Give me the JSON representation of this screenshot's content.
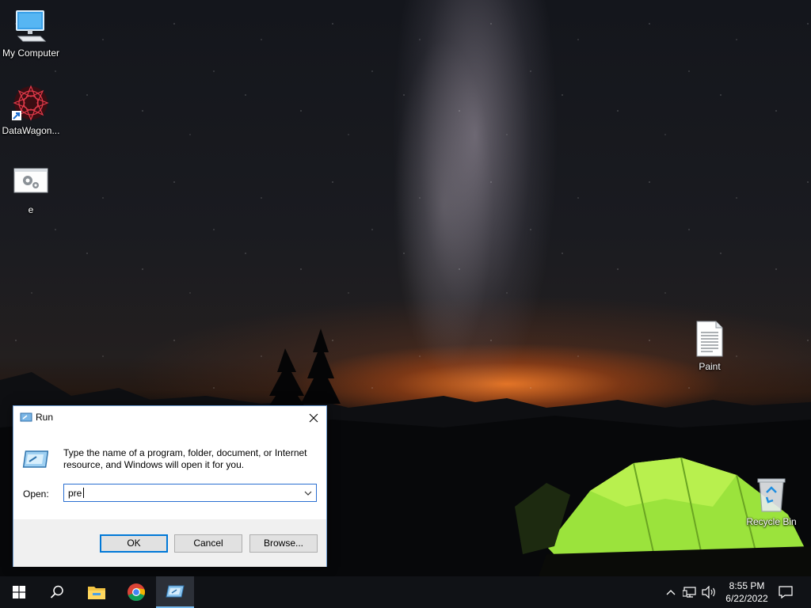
{
  "desktop": {
    "icons": [
      {
        "label": "My Computer",
        "icon": "computer-icon"
      },
      {
        "label": "DataWagon...",
        "icon": "datawagon-shortcut-icon"
      },
      {
        "label": "e",
        "icon": "settings-file-icon"
      },
      {
        "label": "Paint",
        "icon": "text-document-icon"
      },
      {
        "label": "Recycle Bin",
        "icon": "recycle-bin-icon"
      }
    ]
  },
  "run_dialog": {
    "title": "Run",
    "description": "Type the name of a program, folder, document, or Internet resource, and Windows will open it for you.",
    "open_label": "Open:",
    "open_value": "pre",
    "buttons": {
      "ok": "OK",
      "cancel": "Cancel",
      "browse": "Browse..."
    }
  },
  "taskbar": {
    "apps": [
      {
        "name": "Start",
        "icon": "windows-start-icon"
      },
      {
        "name": "Search",
        "icon": "search-icon"
      },
      {
        "name": "File Explorer",
        "icon": "folder-icon"
      },
      {
        "name": "Google Chrome",
        "icon": "chrome-icon"
      },
      {
        "name": "Run",
        "icon": "run-icon",
        "active": true
      }
    ],
    "clock": {
      "time": "8:55 PM",
      "date": "6/22/2022"
    }
  },
  "colors": {
    "accent": "#0078d7",
    "taskbar": "#101216",
    "dialog_footer": "#f0f0f0"
  }
}
